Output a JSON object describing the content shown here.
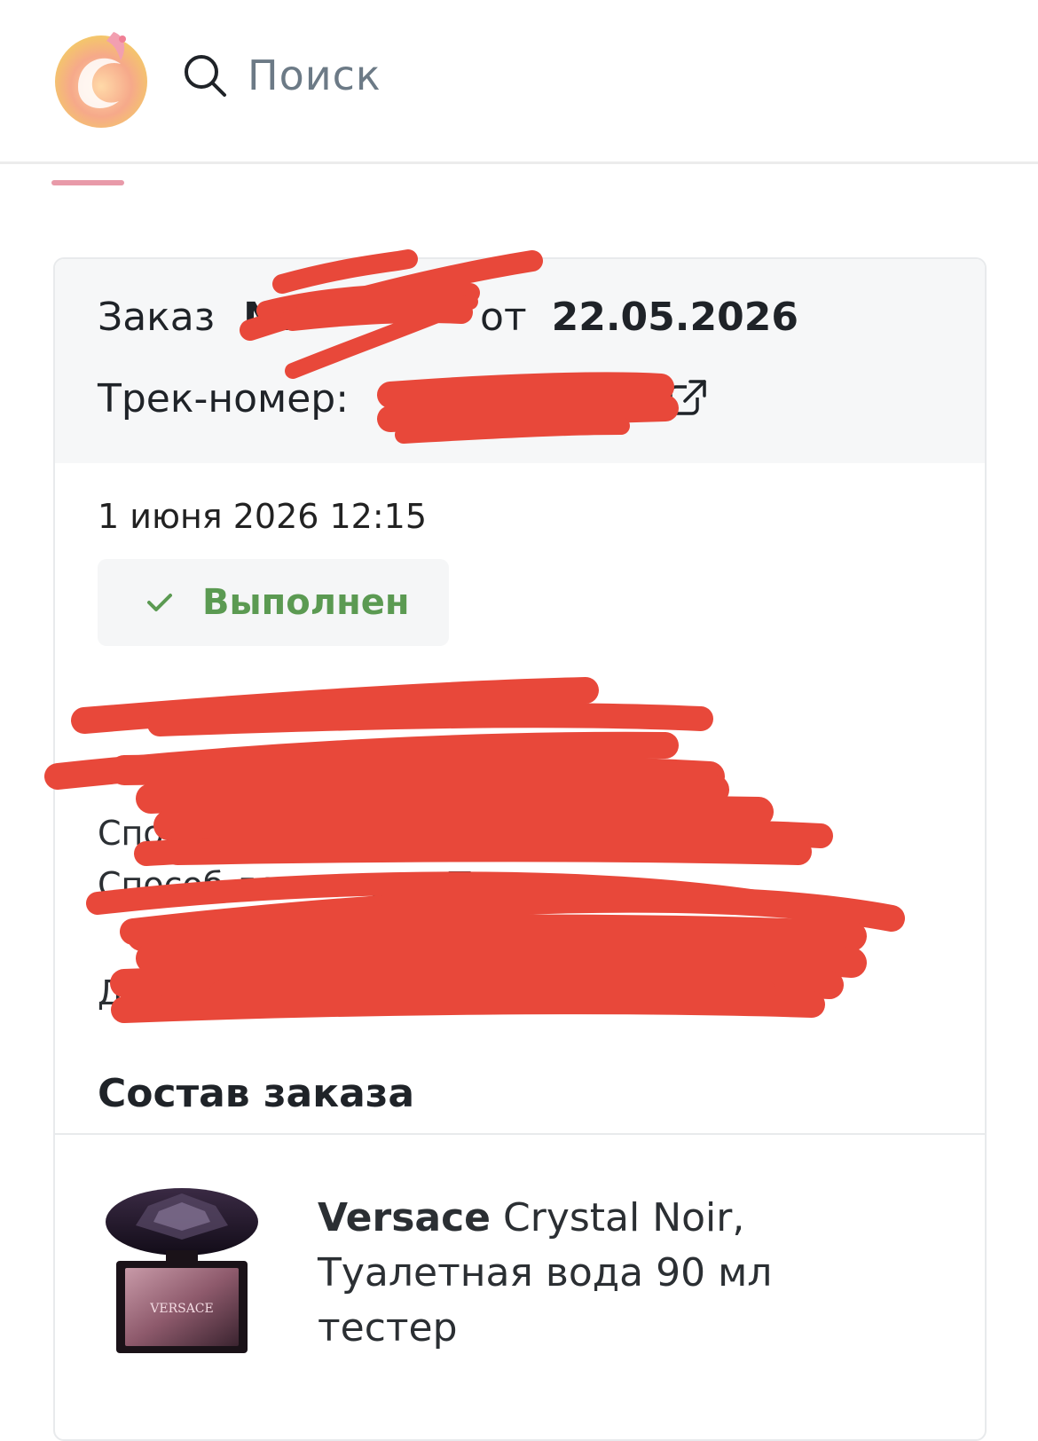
{
  "header": {
    "search_placeholder": "Поиск"
  },
  "order": {
    "label": "Заказ",
    "number_prefix": "№",
    "from_label": "от",
    "date": "22.05.2026",
    "track_label": "Трек-номер:",
    "timestamp": "1 июня 2026 12:15",
    "status": "Выполнен",
    "payment_method_label": "Способ оплаты",
    "delivery_method_label": "Способ доставки",
    "delivery_method_value_partial": "Пункт",
    "date_row_label": "Дата"
  },
  "items_section": {
    "title": "Состав заказа",
    "items": [
      {
        "brand": "Versace",
        "name": "Crystal Noir,",
        "description_line1": "Туалетная вода 90 мл",
        "description_line2": "тестер",
        "bottle_text": "VERSACE"
      }
    ]
  },
  "colors": {
    "accent_pink": "#e89aa9",
    "status_green": "#5b9a52",
    "redaction_red": "#e8483a"
  }
}
